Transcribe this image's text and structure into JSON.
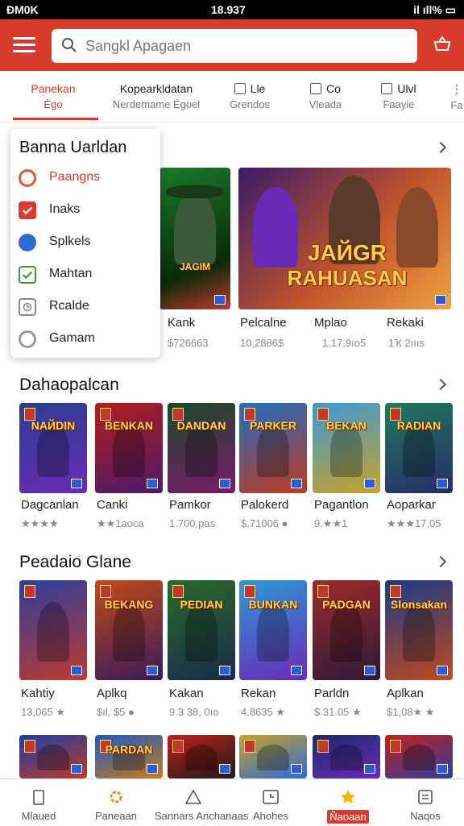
{
  "status_bar": {
    "left": "ĐM0K",
    "center": "18.937",
    "right": "il ıll% ▭"
  },
  "search": {
    "placeholder": "Sangkl Apagaen"
  },
  "tabs": [
    {
      "line1": "Panekan",
      "line2": "Ėgo",
      "active": true
    },
    {
      "line1": "Kopearkldatan",
      "line2": "Nerdemame Ėgoel"
    },
    {
      "line1": "Lle",
      "line2": "Grendos"
    },
    {
      "line1": "Co",
      "line2": "Vleada"
    },
    {
      "line1": "Ulvl",
      "line2": "Faayie"
    },
    {
      "line1": "⋮",
      "line2": "Fa"
    }
  ],
  "dropdown": {
    "title": "Banna Uarldan",
    "items": [
      {
        "label": "Paangns",
        "icon": "orange-ring-icon",
        "color": "#e8552a",
        "active": true
      },
      {
        "label": "Inaks",
        "icon": "red-check-icon",
        "color": "#d83a2c"
      },
      {
        "label": "Splkels",
        "icon": "blue-circle-icon",
        "color": "#2d6bd8"
      },
      {
        "label": "Mahtan",
        "icon": "green-check-icon",
        "color": "#4b9a2a"
      },
      {
        "label": "Rcalde",
        "icon": "gray-clock-icon",
        "color": "#888888"
      },
      {
        "label": "Gamam",
        "icon": "gray-circle-icon",
        "color": "#999999"
      }
    ]
  },
  "featured": {
    "banner_title_line1": "JAЙGR",
    "banner_title_line2": "RAHUASAN",
    "side_card_title": "JAGIM",
    "items": [
      {
        "name": "Kank",
        "sub": "$726663"
      },
      {
        "name": "Pelcalne",
        "sub": "10,2886$"
      },
      {
        "name": "Mplao",
        "sub": "1.17,9ıo5"
      },
      {
        "name": "Rekaki",
        "sub": "1Ҡ 2ıııs"
      }
    ]
  },
  "section2": {
    "title": "Dahaopalcan",
    "items": [
      {
        "name": "Dagcanlan",
        "sub": "★★★★",
        "art": "NAЙDIN",
        "c1": "#2a3f8f",
        "c2": "#6b2ab8"
      },
      {
        "name": "Canki",
        "sub": "★★1aoca",
        "art": "BENKAN",
        "c1": "#b21d1d",
        "c2": "#4a1a6a"
      },
      {
        "name": "Pamkor",
        "sub": "1.700,pas",
        "art": "DANDAN",
        "c1": "#1a4a2a",
        "c2": "#7a1a6a"
      },
      {
        "name": "Palokerd",
        "sub": "$.71006 ●",
        "art": "PARKER",
        "c1": "#1e6fc2",
        "c2": "#c2381e"
      },
      {
        "name": "Pagantlon",
        "sub": "9.★★1",
        "art": "BEKAN",
        "c1": "#3a9ad6",
        "c2": "#c9a227"
      },
      {
        "name": "Aoparkar",
        "sub": "★★★17,05",
        "art": "RADIAN",
        "c1": "#1d7a5a",
        "c2": "#2a2a6b"
      }
    ]
  },
  "section3": {
    "title": "Peadaio Glane",
    "items": [
      {
        "name": "Kahtiy",
        "sub": "13,065 ★",
        "art": "",
        "c1": "#2a3fa0",
        "c2": "#c0392b"
      },
      {
        "name": "Aplkq",
        "sub": "$ıl, $5 ●",
        "art": "BEKANG",
        "c1": "#c04a1a",
        "c2": "#3a1a5a"
      },
      {
        "name": "Kakan",
        "sub": "9.3 38, 0ıo",
        "art": "PEDIAN",
        "c1": "#2a6a2a",
        "c2": "#1a2a4a"
      },
      {
        "name": "Rekan",
        "sub": "4.8635 ★",
        "art": "BUNKAN",
        "c1": "#2a9ad6",
        "c2": "#6b2ab8"
      },
      {
        "name": "Parldn",
        "sub": "$.31.05 ★",
        "art": "PADGAN",
        "c1": "#a02a2a",
        "c2": "#2a1a3a"
      },
      {
        "name": "Aplkan",
        "sub": "$1,08★ ★",
        "art": "Slonsakan",
        "c1": "#1a3a8a",
        "c2": "#c04a1a"
      }
    ]
  },
  "section4_items": [
    {
      "art": "",
      "c1": "#1a3fa0",
      "c2": "#c0392b"
    },
    {
      "art": "PARDAN",
      "c1": "#1a5ac0",
      "c2": "#c97a1a"
    },
    {
      "art": "",
      "c1": "#c0201a",
      "c2": "#1a1a1a"
    },
    {
      "art": "",
      "c1": "#c9a227",
      "c2": "#2a6ad6"
    },
    {
      "art": "",
      "c1": "#1a2a6a",
      "c2": "#6b2ab8"
    },
    {
      "art": "",
      "c1": "#c0201a",
      "c2": "#2a3fa0"
    }
  ],
  "bottom_nav": [
    {
      "label": "Mlaued",
      "icon": "phone-icon"
    },
    {
      "label": "Paneaan",
      "icon": "flower-icon"
    },
    {
      "label": "Sannars Anchanaas",
      "icon": "warning-icon"
    },
    {
      "label": "Ahohes",
      "icon": "clock-icon"
    },
    {
      "label": "Ñaoaan",
      "icon": "star-icon",
      "active": true
    },
    {
      "label": "Naqos",
      "icon": "list-icon"
    }
  ]
}
